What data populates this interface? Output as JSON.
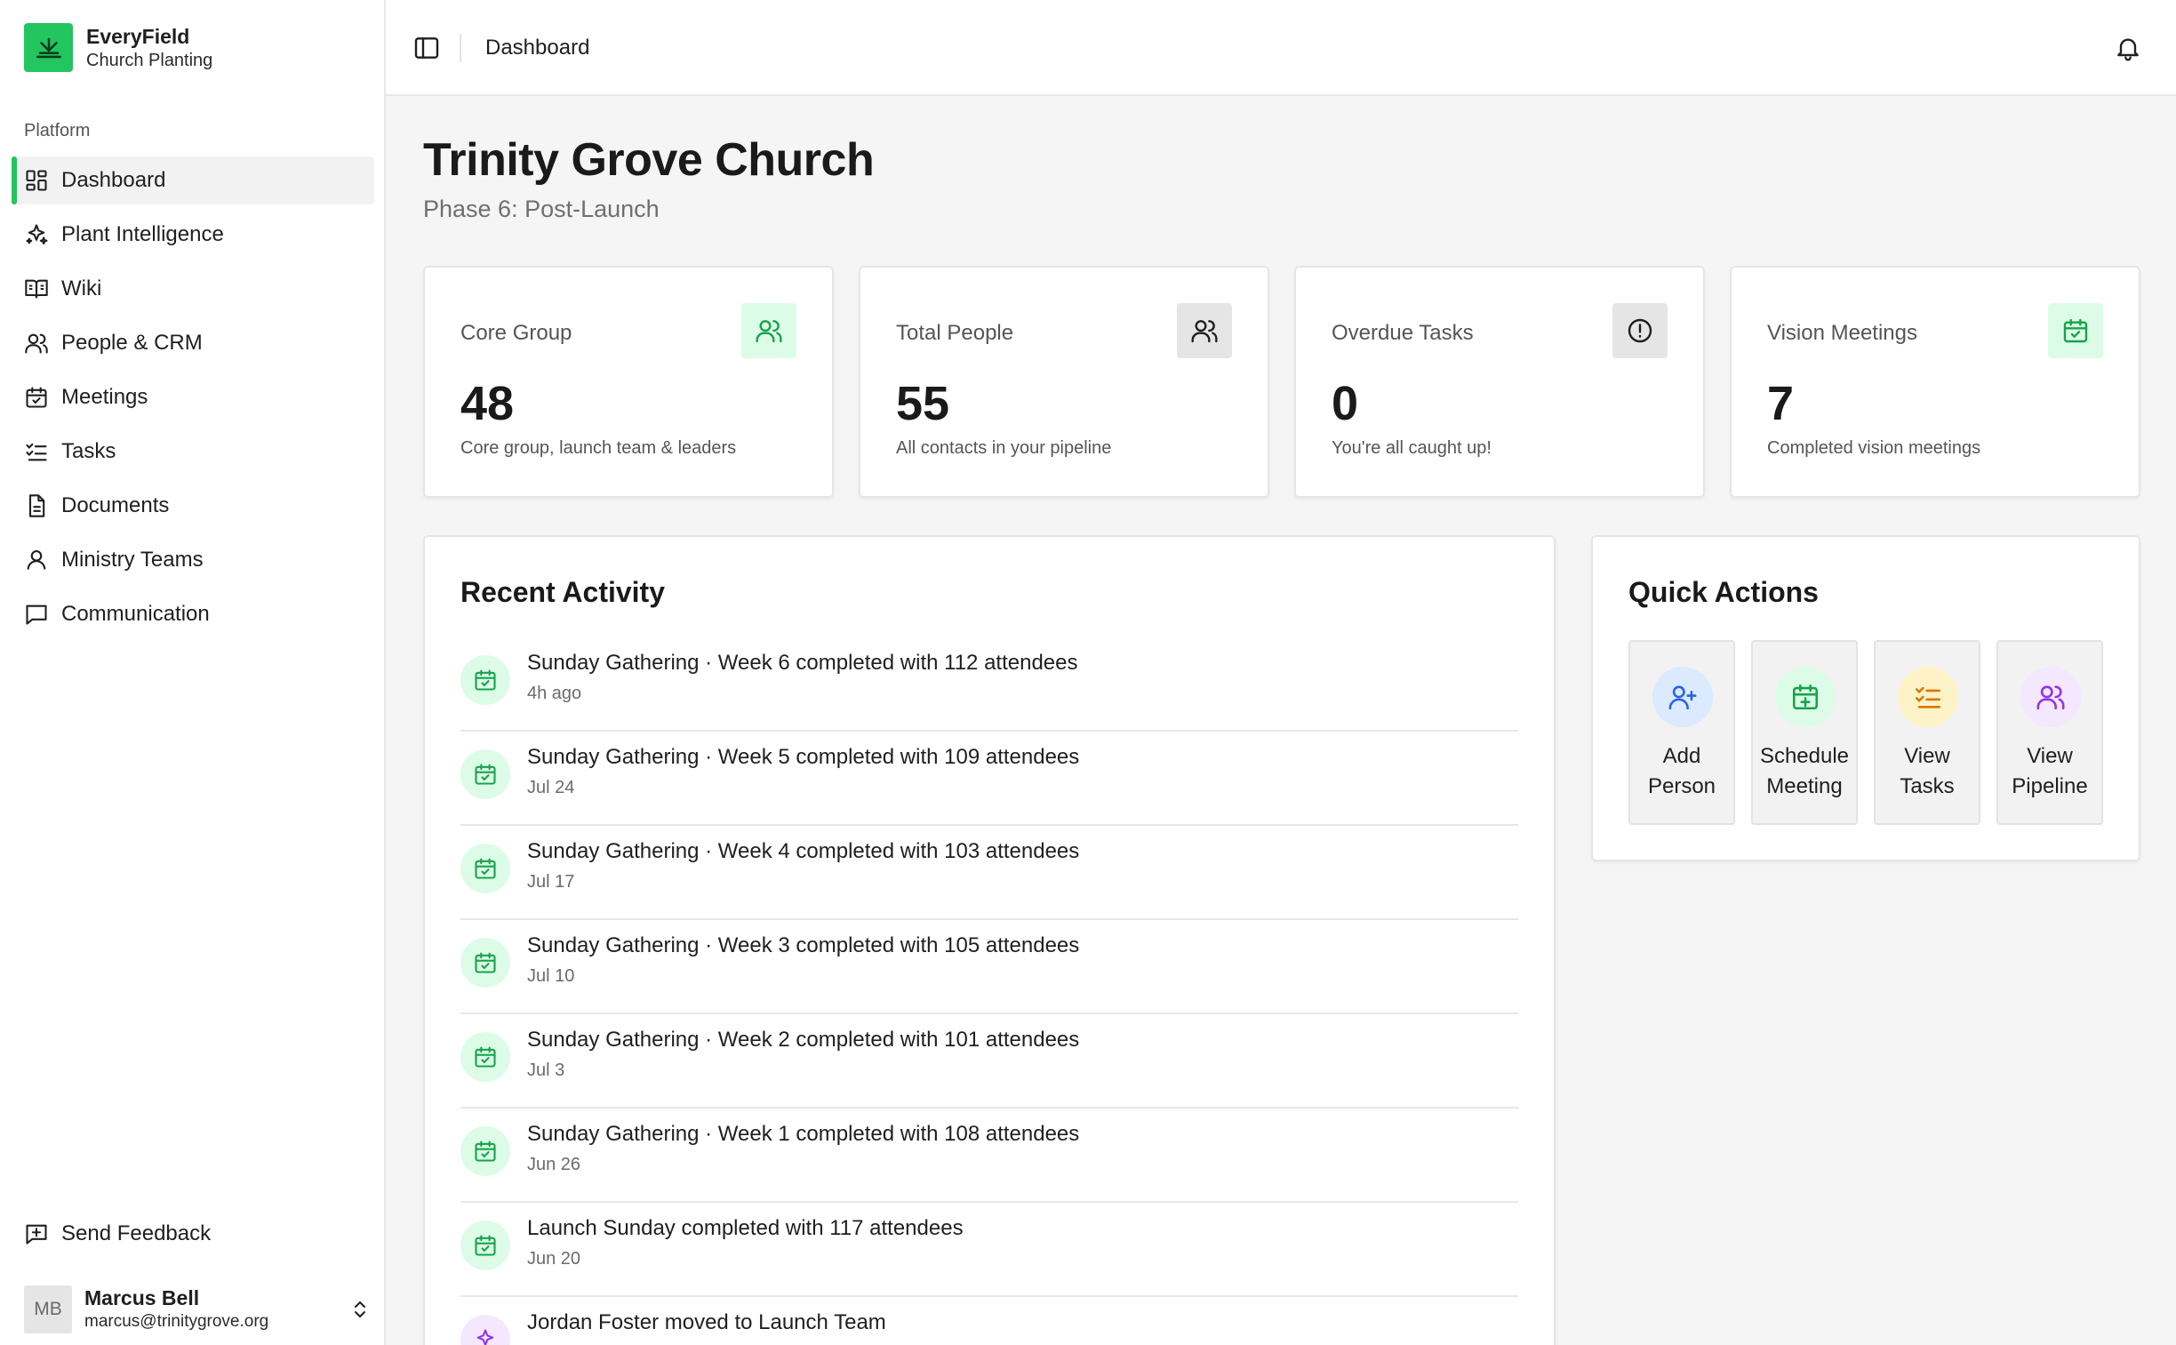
{
  "brand": {
    "name": "EveryField",
    "subtitle": "Church Planting",
    "accent": "#22c55e"
  },
  "sidebar": {
    "section_label": "Platform",
    "items": [
      {
        "label": "Dashboard",
        "icon": "dashboard-grid-icon",
        "active": true
      },
      {
        "label": "Plant Intelligence",
        "icon": "sparkles-icon"
      },
      {
        "label": "Wiki",
        "icon": "book-open-icon"
      },
      {
        "label": "People & CRM",
        "icon": "users-icon"
      },
      {
        "label": "Meetings",
        "icon": "calendar-check-icon"
      },
      {
        "label": "Tasks",
        "icon": "list-checks-icon"
      },
      {
        "label": "Documents",
        "icon": "document-icon"
      },
      {
        "label": "Ministry Teams",
        "icon": "user-icon"
      },
      {
        "label": "Communication",
        "icon": "message-square-icon"
      }
    ],
    "feedback_label": "Send Feedback",
    "user": {
      "initials": "MB",
      "name": "Marcus Bell",
      "email": "marcus@trinitygrove.org"
    }
  },
  "topbar": {
    "title": "Dashboard"
  },
  "page": {
    "title": "Trinity Grove Church",
    "subtitle": "Phase 6: Post-Launch"
  },
  "stats": [
    {
      "label": "Core Group",
      "value": "48",
      "desc": "Core group, launch team & leaders",
      "icon": "users-icon",
      "icon_bg": "#dcfce7",
      "icon_color": "#16a34a"
    },
    {
      "label": "Total People",
      "value": "55",
      "desc": "All contacts in your pipeline",
      "icon": "users-icon",
      "icon_bg": "#e5e5e5",
      "icon_color": "#1f1f1f"
    },
    {
      "label": "Overdue Tasks",
      "value": "0",
      "desc": "You're all caught up!",
      "icon": "alert-circle-icon",
      "icon_bg": "#e5e5e5",
      "icon_color": "#1f1f1f"
    },
    {
      "label": "Vision Meetings",
      "value": "7",
      "desc": "Completed vision meetings",
      "icon": "calendar-check-icon",
      "icon_bg": "#dcfce7",
      "icon_color": "#16a34a"
    }
  ],
  "recent_activity": {
    "title": "Recent Activity",
    "items": [
      {
        "title": "Sunday Gathering · Week 6 completed with 112 attendees",
        "time": "4h ago",
        "icon": "calendar-check-icon"
      },
      {
        "title": "Sunday Gathering · Week 5 completed with 109 attendees",
        "time": "Jul 24",
        "icon": "calendar-check-icon"
      },
      {
        "title": "Sunday Gathering · Week 4 completed with 103 attendees",
        "time": "Jul 17",
        "icon": "calendar-check-icon"
      },
      {
        "title": "Sunday Gathering · Week 3 completed with 105 attendees",
        "time": "Jul 10",
        "icon": "calendar-check-icon"
      },
      {
        "title": "Sunday Gathering · Week 2 completed with 101 attendees",
        "time": "Jul 3",
        "icon": "calendar-check-icon"
      },
      {
        "title": "Sunday Gathering · Week 1 completed with 108 attendees",
        "time": "Jun 26",
        "icon": "calendar-check-icon"
      },
      {
        "title": "Launch Sunday completed with 117 attendees",
        "time": "Jun 20",
        "icon": "calendar-check-icon"
      },
      {
        "title": "Jordan Foster moved to Launch Team",
        "time": "",
        "icon": "sparkles-icon"
      }
    ]
  },
  "quick_actions": {
    "title": "Quick Actions",
    "items": [
      {
        "label": "Add Person",
        "icon": "user-plus-icon",
        "bg": "#dbeafe",
        "color": "#2563eb"
      },
      {
        "label": "Schedule Meeting",
        "icon": "calendar-plus-icon",
        "bg": "#dcfce7",
        "color": "#16a34a"
      },
      {
        "label": "View Tasks",
        "icon": "list-checks-icon",
        "bg": "#fef3c7",
        "color": "#d97706"
      },
      {
        "label": "View Pipeline",
        "icon": "users-icon",
        "bg": "#f3e8ff",
        "color": "#9333ea"
      }
    ]
  }
}
